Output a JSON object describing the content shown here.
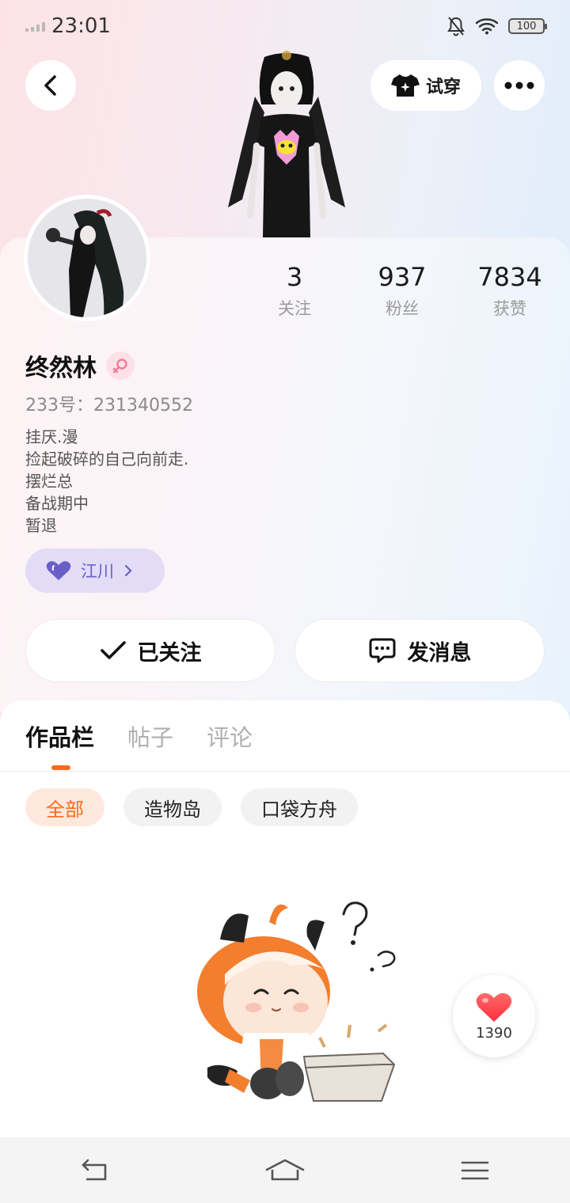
{
  "status_bar": {
    "time": "23:01",
    "battery": "100"
  },
  "header": {
    "try_on_label": "试穿"
  },
  "profile": {
    "name": "终然林",
    "uid_line": "233号：231340552",
    "bio": [
      "挂厌.漫",
      "捡起破碎的自己向前走.",
      "摆烂总",
      "备战期中",
      "暂退"
    ],
    "tag_label": "江川",
    "stats": [
      {
        "value": "3",
        "label": "关注"
      },
      {
        "value": "937",
        "label": "粉丝"
      },
      {
        "value": "7834",
        "label": "获赞"
      }
    ]
  },
  "actions": {
    "follow_label": "已关注",
    "message_label": "发消息"
  },
  "tabs": [
    {
      "label": "作品栏",
      "active": true
    },
    {
      "label": "帖子",
      "active": false
    },
    {
      "label": "评论",
      "active": false
    }
  ],
  "filters": [
    {
      "label": "全部",
      "active": true
    },
    {
      "label": "造物岛",
      "active": false
    },
    {
      "label": "口袋方舟",
      "active": false
    }
  ],
  "like_button": {
    "count": "1390"
  },
  "colors": {
    "accent": "#ff6a1a",
    "tag_bg": "#e2dcf7",
    "tag_text": "#6a5fc8",
    "heart": "#ff3b47"
  }
}
